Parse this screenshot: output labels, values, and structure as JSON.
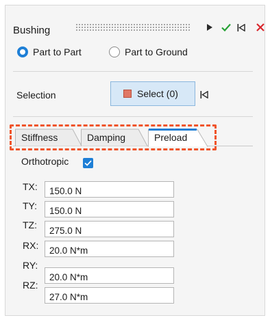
{
  "panel": {
    "title": "Bushing"
  },
  "connection": {
    "options": [
      "Part to Part",
      "Part to Ground"
    ],
    "selected": "Part to Part"
  },
  "selection": {
    "label": "Selection",
    "button_label": "Select (0)"
  },
  "tabs": [
    "Stiffness",
    "Damping",
    "Preload"
  ],
  "active_tab": "Preload",
  "orthotropic": {
    "label": "Orthotropic",
    "checked": true
  },
  "fields": [
    {
      "label": "TX:",
      "value": "150.0 N"
    },
    {
      "label": "TY:",
      "value": "150.0 N"
    },
    {
      "label": "TZ:",
      "value": "275.0 N"
    },
    {
      "label": "RX:",
      "value": "20.0 N*m"
    },
    {
      "label": "RY:",
      "value": "20.0 N*m"
    },
    {
      "label": "RZ:",
      "value": "27.0 N*m"
    }
  ],
  "colors": {
    "accent": "#1e7fd6",
    "confirm": "#27a236",
    "cancel": "#d9262c",
    "highlight": "#f0542a"
  },
  "icons": [
    "play-icon",
    "check-icon",
    "skip-back-icon",
    "close-icon"
  ]
}
